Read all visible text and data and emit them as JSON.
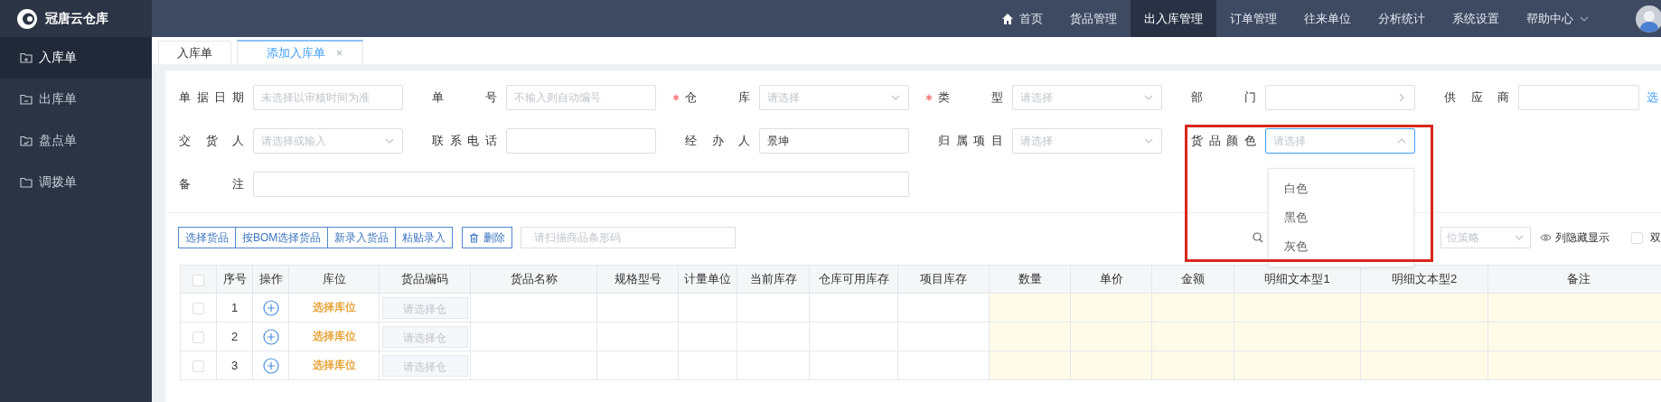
{
  "brand": {
    "name": "冠唐云仓库"
  },
  "nav": [
    {
      "label": "首页",
      "kind": "home",
      "selected": false
    },
    {
      "label": "货品管理",
      "kind": "plain",
      "selected": false
    },
    {
      "label": "出入库管理",
      "kind": "plain",
      "selected": true
    },
    {
      "label": "订单管理",
      "kind": "plain",
      "selected": false
    },
    {
      "label": "往来单位",
      "kind": "plain",
      "selected": false
    },
    {
      "label": "分析统计",
      "kind": "plain",
      "selected": false
    },
    {
      "label": "系统设置",
      "kind": "plain",
      "selected": false
    },
    {
      "label": "帮助中心",
      "kind": "menu",
      "selected": false
    }
  ],
  "sidebar": {
    "items": [
      {
        "label": "入库单",
        "selected": true
      },
      {
        "label": "出库单",
        "selected": false
      },
      {
        "label": "盘点单",
        "selected": false
      },
      {
        "label": "调拨单",
        "selected": false
      }
    ]
  },
  "tabs": [
    {
      "label": "入库单",
      "selected": false
    },
    {
      "label": "添加入库单",
      "selected": true,
      "close": "×"
    }
  ],
  "form": {
    "rows": [
      [
        {
          "label": "单据日期",
          "kind": "text",
          "required": false,
          "highlighted": false,
          "placeholder": "未选择以审核时间为准"
        },
        {
          "label": "单号",
          "kind": "text",
          "required": false,
          "highlighted": false,
          "placeholder": "不输入则自动编号"
        },
        {
          "label": "仓库",
          "kind": "select",
          "required": true,
          "highlighted": false,
          "open": false,
          "placeholder": "请选择"
        },
        {
          "label": "类型",
          "kind": "select",
          "required": true,
          "highlighted": false,
          "open": false,
          "placeholder": "请选择"
        },
        {
          "label": "部门",
          "kind": "cascade",
          "required": false,
          "highlighted": false
        },
        {
          "label": "供应商",
          "kind": "text",
          "required": false,
          "highlighted": false,
          "link": "选"
        }
      ],
      [
        {
          "label": "交货人",
          "kind": "select",
          "required": false,
          "highlighted": false,
          "open": false,
          "placeholder": "请选择或输入"
        },
        {
          "label": "联系电话",
          "kind": "text",
          "required": false,
          "highlighted": false
        },
        {
          "label": "经办人",
          "kind": "text",
          "required": false,
          "highlighted": false,
          "value": "景坤"
        },
        {
          "label": "归属项目",
          "kind": "select",
          "required": false,
          "highlighted": false,
          "open": false,
          "placeholder": "请选择"
        },
        {
          "label": "货品颜色",
          "kind": "select",
          "required": false,
          "highlighted": true,
          "open": true,
          "placeholder": "请选择",
          "options": [
            "白色",
            "黑色",
            "灰色"
          ]
        }
      ],
      [
        {
          "label": "备注",
          "kind": "wide",
          "required": false,
          "highlighted": false
        }
      ]
    ]
  },
  "toolbar": {
    "button_group": [
      "选择货品",
      "按BOM选择货品",
      "新录入货品",
      "粘贴录入"
    ],
    "delete": "删除",
    "scan_placeholder": "请扫描商品条形码",
    "strategy_value": "位策略",
    "column_toggle": "列隐藏显示",
    "double_unit": {
      "label": "双",
      "checked": false
    }
  },
  "table": {
    "select_all_checked": false,
    "columns": [
      {
        "label": "序号",
        "kind": "index"
      },
      {
        "label": "操作",
        "kind": "action"
      },
      {
        "label": "库位",
        "kind": "location"
      },
      {
        "label": "货品编码",
        "kind": "code"
      },
      {
        "label": "货品名称",
        "kind": "plain"
      },
      {
        "label": "规格型号",
        "kind": "plain"
      },
      {
        "label": "计量单位",
        "kind": "plain"
      },
      {
        "label": "当前库存",
        "kind": "plain"
      },
      {
        "label": "仓库可用库存",
        "kind": "plain"
      },
      {
        "label": "项目库存",
        "kind": "plain"
      },
      {
        "label": "数量",
        "kind": "entry"
      },
      {
        "label": "单价",
        "kind": "entry"
      },
      {
        "label": "金额",
        "kind": "entry"
      },
      {
        "label": "明细文本型1",
        "kind": "entry"
      },
      {
        "label": "明细文本型2",
        "kind": "entry"
      },
      {
        "label": "备注",
        "kind": "entry"
      }
    ],
    "rows": [
      {
        "checked": false,
        "index": "1",
        "location": "选择库位",
        "code_placeholder": "请选择仓"
      },
      {
        "checked": false,
        "index": "2",
        "location": "选择库位",
        "code_placeholder": "请选择仓"
      },
      {
        "checked": false,
        "index": "3",
        "location": "选择库位",
        "code_placeholder": "请选择仓"
      }
    ]
  }
}
